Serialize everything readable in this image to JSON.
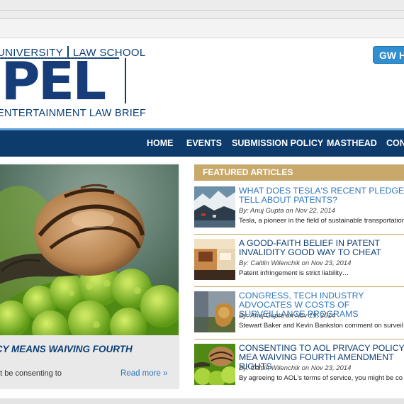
{
  "header": {
    "logo_top_left": "UNIVERSITY",
    "logo_top_right": "LAW SCHOOL",
    "logo_big": "IPEL",
    "logo_bottom": "ENTERTAINMENT LAW BRIEF",
    "gw_button": "GW HO"
  },
  "nav": {
    "items": [
      "HOME",
      "EVENTS",
      "SUBMISSION POLICY",
      "MASTHEAD",
      "CON"
    ]
  },
  "hero": {
    "title": "ICY MEANS WAIVING FOURTH",
    "excerpt": "nt be consenting to",
    "read_more": "Read more »"
  },
  "featured": {
    "heading": "FEATURED ARTICLES",
    "articles": [
      {
        "title": "WHAT DOES TESLA'S RECENT PLEDGE TELL ABOUT PATENTS?",
        "by": "By:",
        "author": "Anuj Gupta",
        "on": "on",
        "date": "Nov 22, 2014",
        "excerpt": "Tesla, a pioneer in the field of sustainable transportation"
      },
      {
        "title": "A GOOD-FAITH BELIEF IN PATENT INVALIDITY GOOD WAY TO CHEAT",
        "by": "By:",
        "author": "Caitlin Wilenchik",
        "on": "on",
        "date": "Nov 23, 2014",
        "excerpt": "Patent infringement is strict liability…"
      },
      {
        "title": "CONGRESS, TECH INDUSTRY ADVOCATES W COSTS OF SURVEILLANCE PROGRAMS",
        "by": "By:",
        "author": "Anuj Gupta",
        "on": "on",
        "date": "Nov 19, 2014",
        "excerpt": "Stewart Baker and Kevin Bankston comment on surveil"
      },
      {
        "title": "CONSENTING TO AOL PRIVACY POLICY MEA WAIVING FOURTH AMENDMENT RIGHTS",
        "by": "By:",
        "author": "Caitlin Wilenchik",
        "on": "on",
        "date": "Nov 23, 2014",
        "excerpt": "By agreeing to AOL's terms of service, you might be co"
      }
    ]
  },
  "colors": {
    "brand_navy": "#0d3b6b",
    "accent_gold": "#c9a86b",
    "link_blue": "#2f77bd",
    "button_blue": "#2f8fd0"
  }
}
